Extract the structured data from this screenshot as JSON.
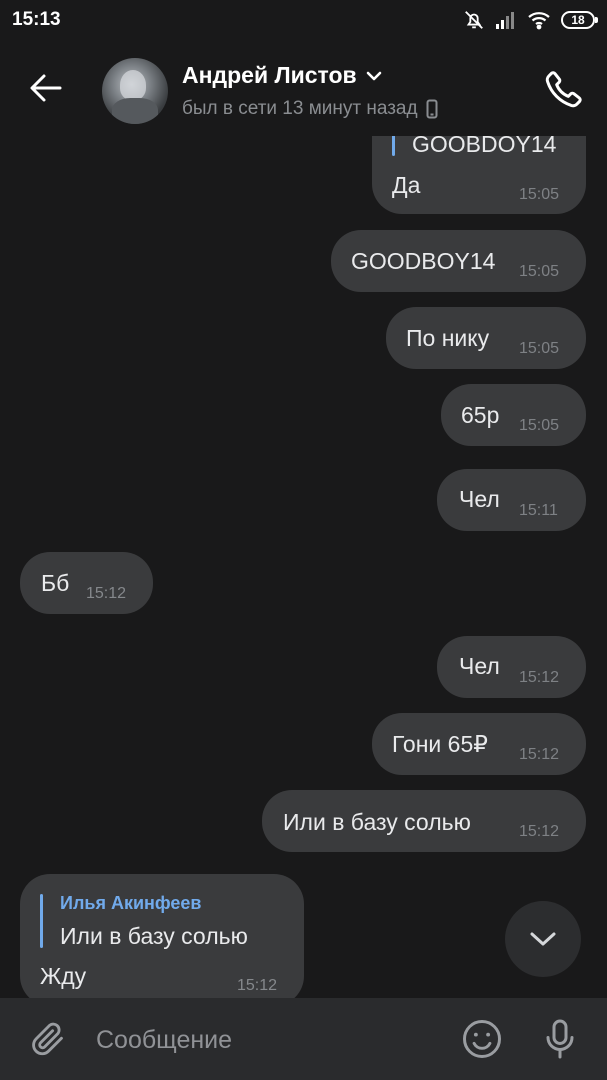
{
  "status_bar": {
    "time": "15:13",
    "battery": "18",
    "icons": [
      "mute-icon",
      "signal-icon",
      "wifi-icon",
      "battery-icon"
    ]
  },
  "header": {
    "contact_name": "Андрей Листов",
    "status": "был в сети 13 минут назад",
    "icons": [
      "back-arrow-icon",
      "chevron-down-icon",
      "mobile-device-icon",
      "phone-icon"
    ]
  },
  "messages": [
    {
      "direction": "out",
      "reply_quote": "GOOBDOY14",
      "text": "Да",
      "time": "15:05"
    },
    {
      "direction": "out",
      "text": "GOODBOY14",
      "time": "15:05"
    },
    {
      "direction": "out",
      "text": "По нику",
      "time": "15:05"
    },
    {
      "direction": "out",
      "text": "65р",
      "time": "15:05"
    },
    {
      "direction": "out",
      "text": "Чел",
      "time": "15:11"
    },
    {
      "direction": "in",
      "text": "Бб",
      "time": "15:12"
    },
    {
      "direction": "out",
      "text": "Чел",
      "time": "15:12"
    },
    {
      "direction": "out",
      "text": "Гони 65₽",
      "time": "15:12"
    },
    {
      "direction": "out",
      "text": "Или в базу солью",
      "time": "15:12"
    },
    {
      "direction": "in",
      "reply_author": "Илья Акинфеев",
      "reply_quote": "Или в базу солью",
      "text": "Жду",
      "time": "15:12"
    }
  ],
  "composer": {
    "placeholder": "Сообщение",
    "icons": [
      "paperclip-icon",
      "emoji-icon",
      "microphone-icon"
    ]
  },
  "colors": {
    "background": "#19191a",
    "bubble": "#3a3b3d",
    "composer": "#2a2b2d",
    "accent": "#71aaeb"
  }
}
